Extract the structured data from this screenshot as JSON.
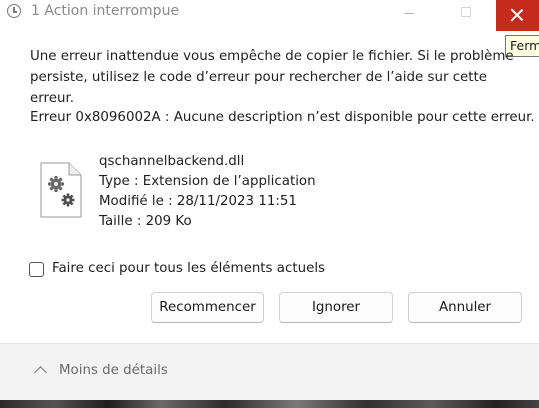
{
  "window": {
    "title": "1 Action interrompue",
    "tooltip": "Ferm"
  },
  "message": {
    "text": "Une erreur inattendue vous empêche de copier le fichier. Si le problème persiste, utilisez le code d’erreur pour rechercher de l’aide sur cette erreur.",
    "error": "Erreur 0x8096002A : Aucune description n’est disponible pour cette erreur."
  },
  "file": {
    "icon": "settings-file-icon",
    "name": "qschannelbackend.dll",
    "type": "Type : Extension de l’application",
    "modified": "Modifié le : 28/11/2023 11:51",
    "size": "Taille : 209 Ko"
  },
  "checkbox": {
    "label": "Faire ceci pour tous les éléments actuels",
    "checked": false
  },
  "buttons": {
    "retry": "Recommencer",
    "ignore": "Ignorer",
    "cancel": "Annuler"
  },
  "footer": {
    "details_label": "Moins de détails"
  },
  "colors": {
    "close_button": "#c42b1c",
    "footer_bg": "#f3f3f3",
    "tooltip_bg": "#ffffe1"
  }
}
